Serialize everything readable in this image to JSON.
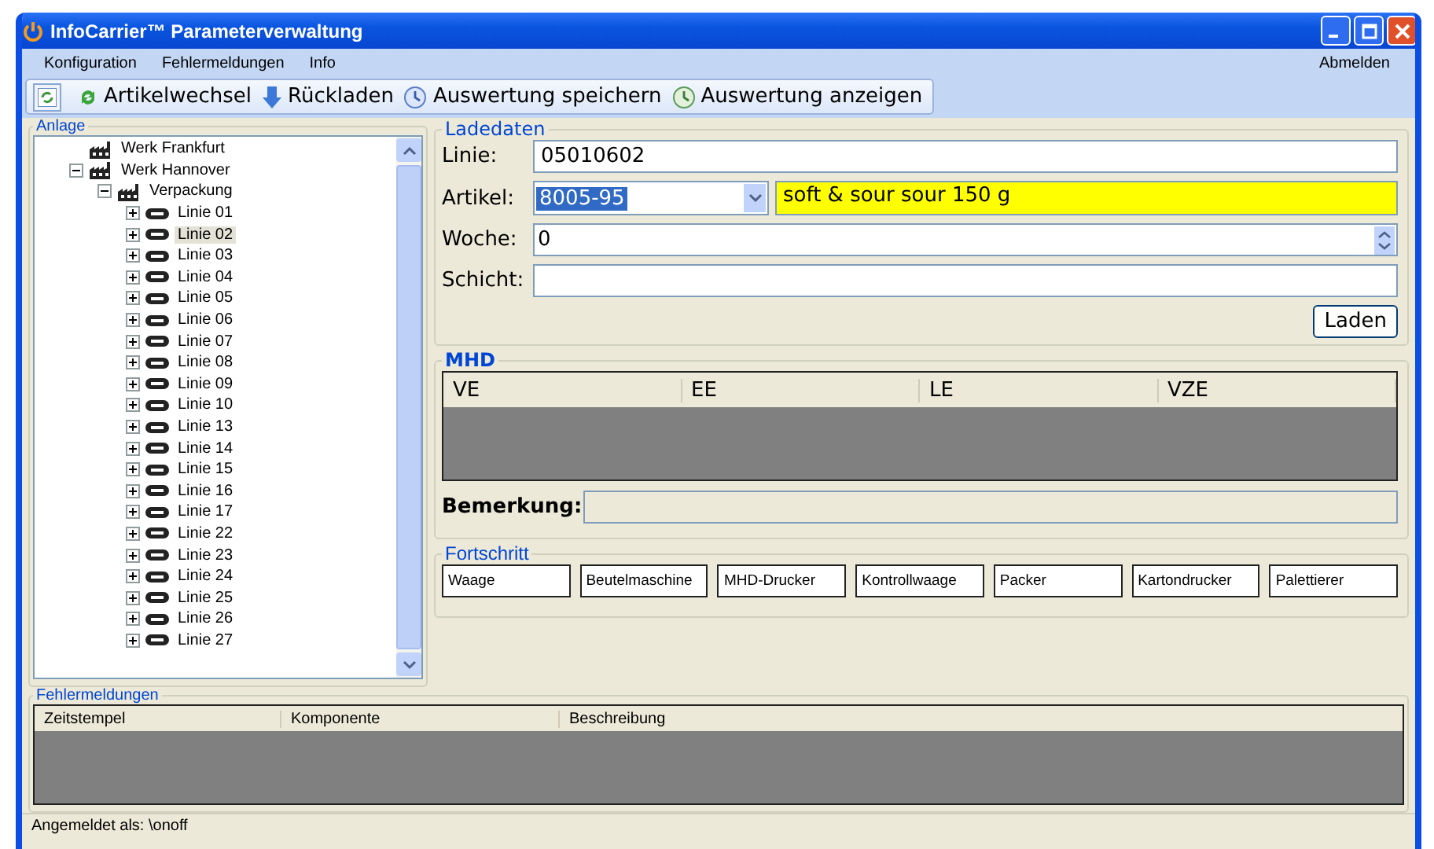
{
  "window": {
    "title": "InfoCarrier™ Parameterverwaltung"
  },
  "menu": [
    "Konfiguration",
    "Fehlermeldungen",
    "Info"
  ],
  "logout": "Abmelden",
  "toolbar": [
    {
      "kind": "switch",
      "label": "Artikelwechsel"
    },
    {
      "kind": "download",
      "label": "Rückladen"
    },
    {
      "kind": "save",
      "label": "Auswertung speichern"
    },
    {
      "kind": "view",
      "label": "Auswertung anzeigen"
    }
  ],
  "anlage": {
    "title": "Anlage",
    "tree": [
      {
        "label": "Werk Frankfurt",
        "kind": "plant",
        "selected": false
      },
      {
        "label": "Werk Hannover",
        "kind": "plant",
        "selected": false,
        "expanded": true,
        "children": [
          {
            "label": "Verpackung",
            "kind": "plant",
            "selected": false,
            "expanded": true,
            "children": [
              {
                "label": "Linie 01",
                "kind": "line",
                "selected": false,
                "expanded": false
              },
              {
                "label": "Linie 02",
                "kind": "line",
                "selected": true,
                "expanded": false
              },
              {
                "label": "Linie 03",
                "kind": "line",
                "selected": false,
                "expanded": false
              },
              {
                "label": "Linie 04",
                "kind": "line",
                "selected": false,
                "expanded": false
              },
              {
                "label": "Linie 05",
                "kind": "line",
                "selected": false,
                "expanded": false
              },
              {
                "label": "Linie 06",
                "kind": "line",
                "selected": false,
                "expanded": false
              },
              {
                "label": "Linie 07",
                "kind": "line",
                "selected": false,
                "expanded": false
              },
              {
                "label": "Linie 08",
                "kind": "line",
                "selected": false,
                "expanded": false
              },
              {
                "label": "Linie 09",
                "kind": "line",
                "selected": false,
                "expanded": false
              },
              {
                "label": "Linie 10",
                "kind": "line",
                "selected": false,
                "expanded": false
              },
              {
                "label": "Linie 13",
                "kind": "line",
                "selected": false,
                "expanded": false
              },
              {
                "label": "Linie 14",
                "kind": "line",
                "selected": false,
                "expanded": false
              },
              {
                "label": "Linie 15",
                "kind": "line",
                "selected": false,
                "expanded": false
              },
              {
                "label": "Linie 16",
                "kind": "line",
                "selected": false,
                "expanded": false
              },
              {
                "label": "Linie 17",
                "kind": "line",
                "selected": false,
                "expanded": false
              },
              {
                "label": "Linie 22",
                "kind": "line",
                "selected": false,
                "expanded": false
              },
              {
                "label": "Linie 23",
                "kind": "line",
                "selected": false,
                "expanded": false
              },
              {
                "label": "Linie 24",
                "kind": "line",
                "selected": false,
                "expanded": false
              },
              {
                "label": "Linie 25",
                "kind": "line",
                "selected": false,
                "expanded": false
              },
              {
                "label": "Linie 26",
                "kind": "line",
                "selected": false,
                "expanded": false
              },
              {
                "label": "Linie 27",
                "kind": "line",
                "selected": false,
                "expanded": false
              }
            ]
          }
        ]
      }
    ]
  },
  "ladedaten": {
    "title": "Ladedaten",
    "linie": {
      "label": "Linie:",
      "value": "05010602"
    },
    "artikel": {
      "label": "Artikel:",
      "value": "8005-95",
      "description": "soft & sour sour 150 g"
    },
    "woche": {
      "label": "Woche:",
      "value": "0"
    },
    "schicht": {
      "label": "Schicht:"
    },
    "load_button": "Laden"
  },
  "mhd": {
    "title": "MHD",
    "columns": [
      "VE",
      "EE",
      "LE",
      "VZE"
    ],
    "remark_label": "Bemerkung:"
  },
  "fortschritt": {
    "title": "Fortschritt",
    "stations": [
      "Waage",
      "Beutelmaschine",
      "MHD-Drucker",
      "Kontrollwaage",
      "Packer",
      "Kartondrucker",
      "Palettierer"
    ]
  },
  "fehlermeldungen": {
    "title": "Fehlermeldungen",
    "columns": [
      "Zeitstempel",
      "Komponente",
      "Beschreibung"
    ]
  },
  "status_bar": "Angemeldet als:  \\onoff"
}
